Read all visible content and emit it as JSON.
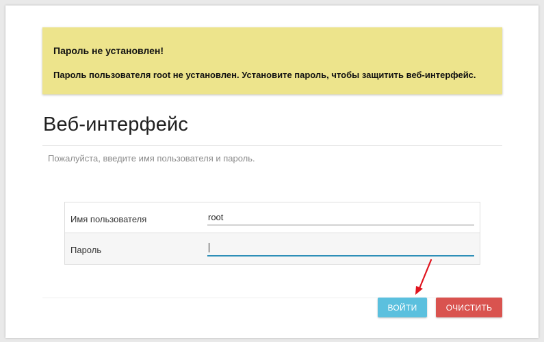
{
  "alert": {
    "title": "Пароль не установлен!",
    "text": "Пароль пользователя root не установлен. Установите пароль, чтобы защитить веб-интерфейс."
  },
  "page": {
    "title": "Веб-интерфейс",
    "hint": "Пожалуйста, введите имя пользователя и пароль."
  },
  "form": {
    "username_label": "Имя пользователя",
    "username_value": "root",
    "password_label": "Пароль",
    "password_value": ""
  },
  "buttons": {
    "login": "ВОЙТИ",
    "reset": "ОЧИСТИТЬ"
  },
  "colors": {
    "alert_bg": "#ede48c",
    "login_button": "#5bc0de",
    "reset_button": "#d9534f",
    "focus_underline": "#2e8fb8",
    "annotation_arrow": "#e0141e"
  },
  "icons": {
    "annotation": "red-arrow-icon"
  }
}
